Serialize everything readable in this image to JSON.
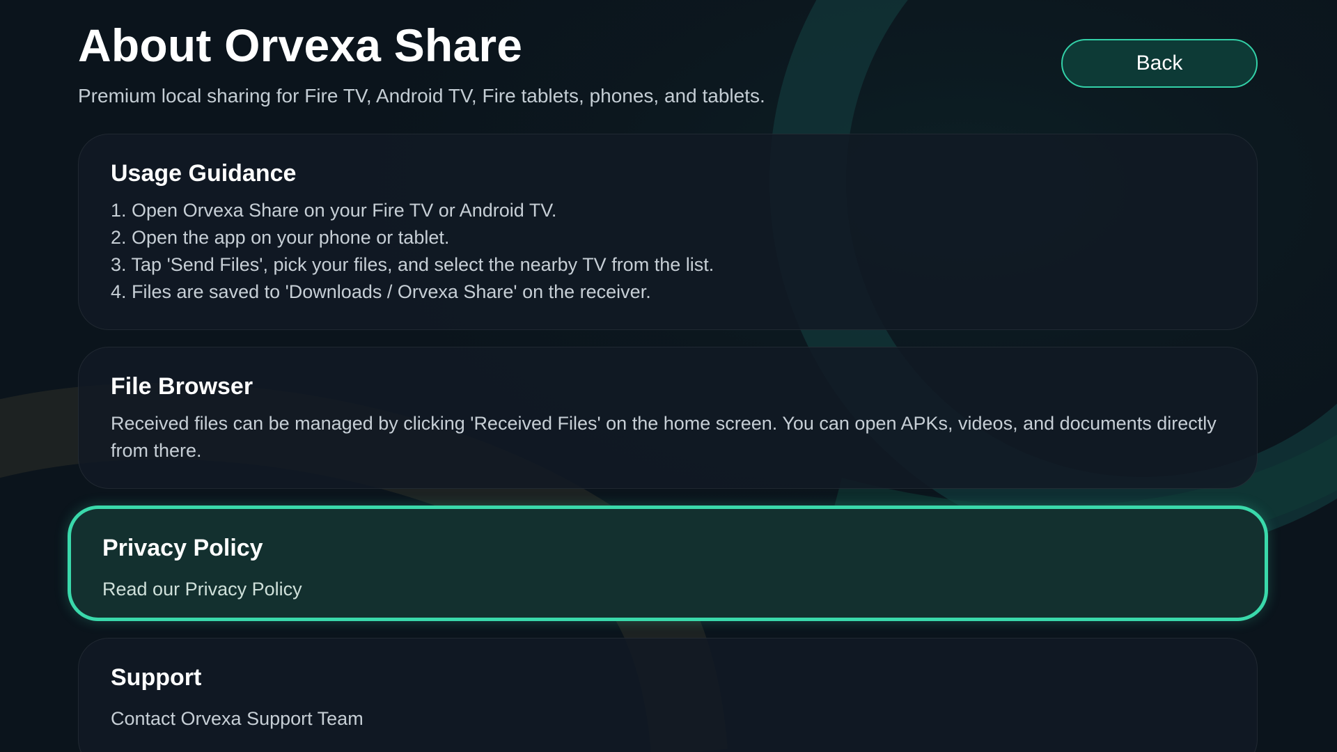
{
  "header": {
    "title": "About Orvexa Share",
    "subtitle": "Premium local sharing for Fire TV, Android TV, Fire tablets, phones, and tablets.",
    "back_label": "Back"
  },
  "sections": {
    "usage": {
      "title": "Usage Guidance",
      "steps": [
        "1. Open Orvexa Share on your Fire TV or Android TV.",
        "2. Open the app on your phone or tablet.",
        "3. Tap 'Send Files', pick your files, and select the nearby TV from the list.",
        "4. Files are saved to 'Downloads / Orvexa Share' on the receiver."
      ]
    },
    "browser": {
      "title": "File Browser",
      "body": "Received files can be managed by clicking 'Received Files' on the home screen. You can open APKs, videos, and documents directly from there."
    },
    "privacy": {
      "title": "Privacy Policy",
      "body": "Read our Privacy Policy"
    },
    "support": {
      "title": "Support",
      "body": "Contact Orvexa Support Team"
    }
  },
  "colors": {
    "background": "#0b141c",
    "accent": "#3ad9ab",
    "card": "#111a24",
    "focused_card": "#13302f"
  }
}
